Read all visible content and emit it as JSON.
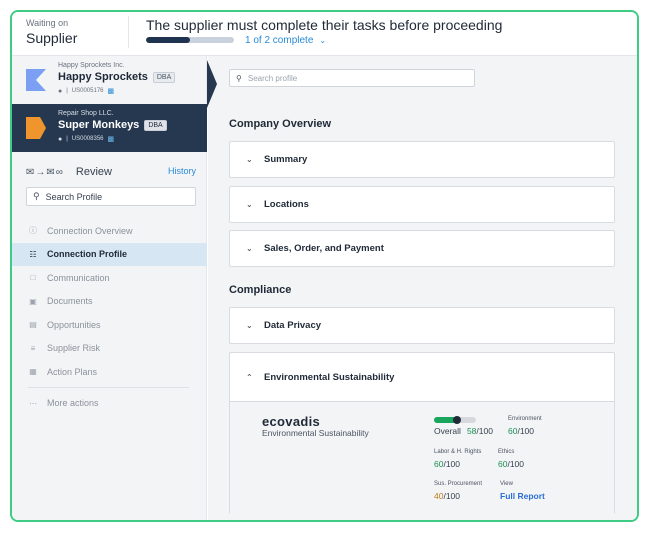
{
  "banner": {
    "waiting_label": "Waiting on",
    "waiting_value": "Supplier",
    "title": "The supplier must complete their tasks before proceeding",
    "progress_text": "1 of 2 complete",
    "progress_fraction": 0.5
  },
  "suppliers": [
    {
      "subname": "Happy Sprockets Inc.",
      "name": "Happy Sprockets",
      "badge": "DBA",
      "id": "US0005176",
      "logo_color": "#7b9ff2",
      "active": false
    },
    {
      "subname": "Repair Shop LLC.",
      "name": "Super Monkeys",
      "badge": "DBA",
      "id": "US0008356",
      "logo_color": "#f0952e",
      "active": true
    }
  ],
  "review": {
    "label": "Review",
    "history": "History"
  },
  "sidebar_search": {
    "placeholder": "Search Profile"
  },
  "nav": [
    {
      "label": "Connection Overview",
      "icon": "info-icon",
      "active": false
    },
    {
      "label": "Connection Profile",
      "icon": "profile-card-icon",
      "active": true
    },
    {
      "label": "Communication",
      "icon": "chat-icon",
      "active": false
    },
    {
      "label": "Documents",
      "icon": "document-icon",
      "active": false
    },
    {
      "label": "Opportunities",
      "icon": "opportunity-icon",
      "active": false
    },
    {
      "label": "Supplier Risk",
      "icon": "risk-list-icon",
      "active": false
    },
    {
      "label": "Action Plans",
      "icon": "action-plan-icon",
      "active": false
    }
  ],
  "more_actions": "More actions",
  "main_search": {
    "placeholder": "Search profile"
  },
  "sections": {
    "company_overview": "Company Overview",
    "compliance": "Compliance"
  },
  "company_accordions": [
    "Summary",
    "Locations",
    "Sales, Order, and Payment"
  ],
  "compliance_accordions": [
    "Data Privacy",
    "Environmental Sustainability"
  ],
  "ecovadis": {
    "logo_text": "ecovadis",
    "subtitle": "Environmental Sustainability",
    "overall_label": "Overall",
    "overall_score": "58",
    "overall_fraction": 0.58,
    "environment_label": "Environment",
    "environment_score": "60",
    "labor_label": "Labor & H. Rights",
    "labor_score": "60",
    "ethics_label": "Ethics",
    "ethics_score": "60",
    "procurement_label": "Sus. Procurement",
    "procurement_score": "40",
    "max": "/100",
    "view_label": "View",
    "full_report": "Full Report"
  },
  "colors": {
    "accent": "#3ecb84",
    "navy": "#26384f",
    "link": "#2a8bd6",
    "score_green": "#1aa55d",
    "score_orange": "#c07b16"
  }
}
